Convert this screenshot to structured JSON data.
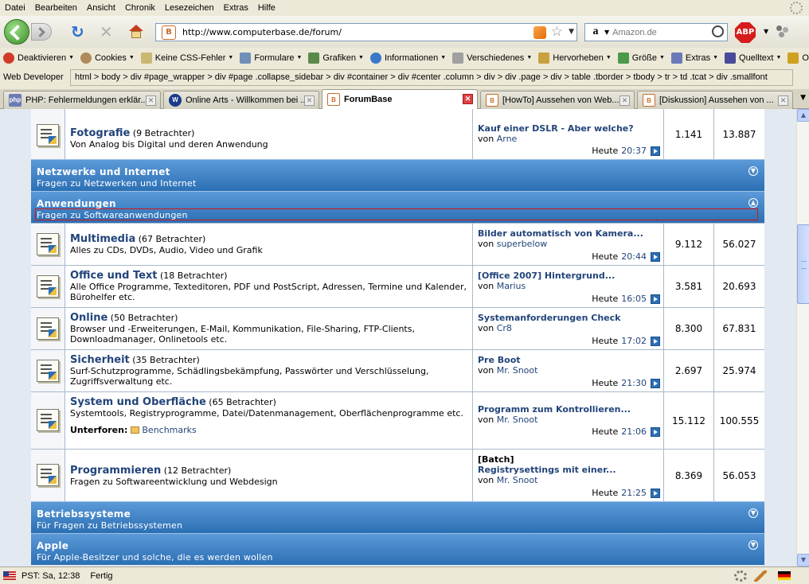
{
  "menubar": {
    "items": [
      {
        "label": "Datei"
      },
      {
        "label": "Bearbeiten"
      },
      {
        "label": "Ansicht"
      },
      {
        "label": "Chronik"
      },
      {
        "label": "Lesezeichen"
      },
      {
        "label": "Extras"
      },
      {
        "label": "Hilfe"
      }
    ]
  },
  "navbar": {
    "url": "http://www.computerbase.de/forum/",
    "search_placeholder": "Amazon.de",
    "abp_label": "ABP",
    "amazon_glyph": "a"
  },
  "webdev": {
    "items": [
      {
        "label": "Deaktivieren",
        "color": "#d23a2a"
      },
      {
        "label": "Cookies",
        "color": "#b08a5a"
      },
      {
        "label": "Keine CSS-Fehler",
        "color": "#c8b872"
      },
      {
        "label": "Formulare",
        "color": "#6f8fb8"
      },
      {
        "label": "Grafiken",
        "color": "#5a8a4a"
      },
      {
        "label": "Informationen",
        "color": "#3a78c8"
      },
      {
        "label": "Verschiedenes",
        "color": "#a0a0a0"
      },
      {
        "label": "Hervorheben",
        "color": "#caa040"
      },
      {
        "label": "Größe",
        "color": "#4a9a4a"
      },
      {
        "label": "Extras",
        "color": "#6a7ab8"
      },
      {
        "label": "Quelltext",
        "color": "#4a4a9a"
      },
      {
        "label": "Optione",
        "color": "#d0a020"
      }
    ],
    "toolbar_label": "Web Developer",
    "dom_path": "html > body > div #page_wrapper > div #page .collapse_sidebar > div #container > div #center .column > div > div .page > div > table .tborder > tbody > tr > td .tcat > div .smallfont"
  },
  "tabs": [
    {
      "title": "PHP: Fehlermeldungen erklär...",
      "icon": "php",
      "icon_color": "#6b7bb3"
    },
    {
      "title": "Online Arts - Willkommen bei ...",
      "icon": "W",
      "icon_color": "#1a3a8a"
    },
    {
      "title": "ForumBase",
      "icon": "B",
      "icon_color": "#c76c2a",
      "active": true
    },
    {
      "title": "[HowTo] Aussehen von Web...",
      "icon": "B",
      "icon_color": "#c76c2a"
    },
    {
      "title": "[Diskussion] Aussehen von ...",
      "icon": "B",
      "icon_color": "#c76c2a"
    }
  ],
  "forum": {
    "top_row": {
      "title": "Fotografie",
      "viewers": "(9 Betrachter)",
      "desc": "Von Analog bis Digital und deren Anwendung",
      "lp_title": "Kauf einer DSLR - Aber welche?",
      "lp_by": "von",
      "lp_user": "Arne",
      "lp_day": "Heute",
      "lp_clock": "20:37",
      "threads": "1.141",
      "posts": "13.887"
    },
    "cat_netz": {
      "title": "Netzwerke und Internet",
      "desc": "Fragen zu Netzwerken und Internet"
    },
    "cat_anw": {
      "title": "Anwendungen",
      "desc": "Fragen zu Softwareanwendungen"
    },
    "rows": [
      {
        "title": "Multimedia",
        "viewers": "(67 Betrachter)",
        "desc": "Alles zu CDs, DVDs, Audio, Video und Grafik",
        "lp_prefix": "",
        "lp_title": "Bilder automatisch von Kamera...",
        "lp_by": "von",
        "lp_user": "superbelow",
        "lp_day": "Heute",
        "lp_clock": "20:44",
        "threads": "9.112",
        "posts": "56.027"
      },
      {
        "title": "Office und Text",
        "viewers": "(18 Betrachter)",
        "desc": "Alle Office Programme, Texteditoren, PDF und PostScript, Adressen, Termine und Kalender, Bürohelfer etc.",
        "lp_prefix": "",
        "lp_title": "[Office 2007] Hintergrund...",
        "lp_by": "von",
        "lp_user": "Marius",
        "lp_day": "Heute",
        "lp_clock": "16:05",
        "threads": "3.581",
        "posts": "20.693"
      },
      {
        "title": "Online",
        "viewers": "(50 Betrachter)",
        "desc": "Browser und -Erweiterungen, E-Mail, Kommunikation, File-Sharing, FTP-Clients, Downloadmanager, Onlinetools etc.",
        "lp_prefix": "",
        "lp_title": "Systemanforderungen Check",
        "lp_by": "von",
        "lp_user": "Cr8",
        "lp_day": "Heute",
        "lp_clock": "17:02",
        "threads": "8.300",
        "posts": "67.831"
      },
      {
        "title": "Sicherheit",
        "viewers": "(35 Betrachter)",
        "desc": "Surf-Schutzprogramme, Schädlingsbekämpfung, Passwörter und Verschlüsselung, Zugriffsverwaltung etc.",
        "lp_prefix": "",
        "lp_title": "Pre Boot",
        "lp_by": "von",
        "lp_user": "Mr. Snoot",
        "lp_day": "Heute",
        "lp_clock": "21:30",
        "threads": "2.697",
        "posts": "25.974"
      },
      {
        "title": "System und Oberfläche",
        "viewers": "(65 Betrachter)",
        "desc": "Systemtools, Registryprogramme, Datei/Datenmanagement, Oberflächenprogramme etc.",
        "sub_label": "Unterforen:",
        "sub_link": "Benchmarks",
        "lp_prefix": "",
        "lp_title": "Programm zum Kontrollieren...",
        "lp_by": "von",
        "lp_user": "Mr. Snoot",
        "lp_day": "Heute",
        "lp_clock": "21:06",
        "threads": "15.112",
        "posts": "100.555"
      },
      {
        "title": "Programmieren",
        "viewers": "(12 Betrachter)",
        "desc": "Fragen zu Softwareentwicklung und Webdesign",
        "lp_prefix": "[Batch]",
        "lp_title": "Registrysettings mit einer...",
        "lp_by": "von",
        "lp_user": "Mr. Snoot",
        "lp_day": "Heute",
        "lp_clock": "21:25",
        "threads": "8.369",
        "posts": "56.053"
      }
    ],
    "cat_betr": {
      "title": "Betriebssysteme",
      "desc": "Für Fragen zu Betriebssystemen"
    },
    "cat_apple": {
      "title": "Apple",
      "desc": "Für Apple-Besitzer und solche, die es werden wollen"
    }
  },
  "statusbar": {
    "time": "PST: Sa, 12:38",
    "status": "Fertig"
  },
  "colors": {
    "category_header": "#2b6fb4",
    "link": "#22447a",
    "outline": "#d01818"
  }
}
